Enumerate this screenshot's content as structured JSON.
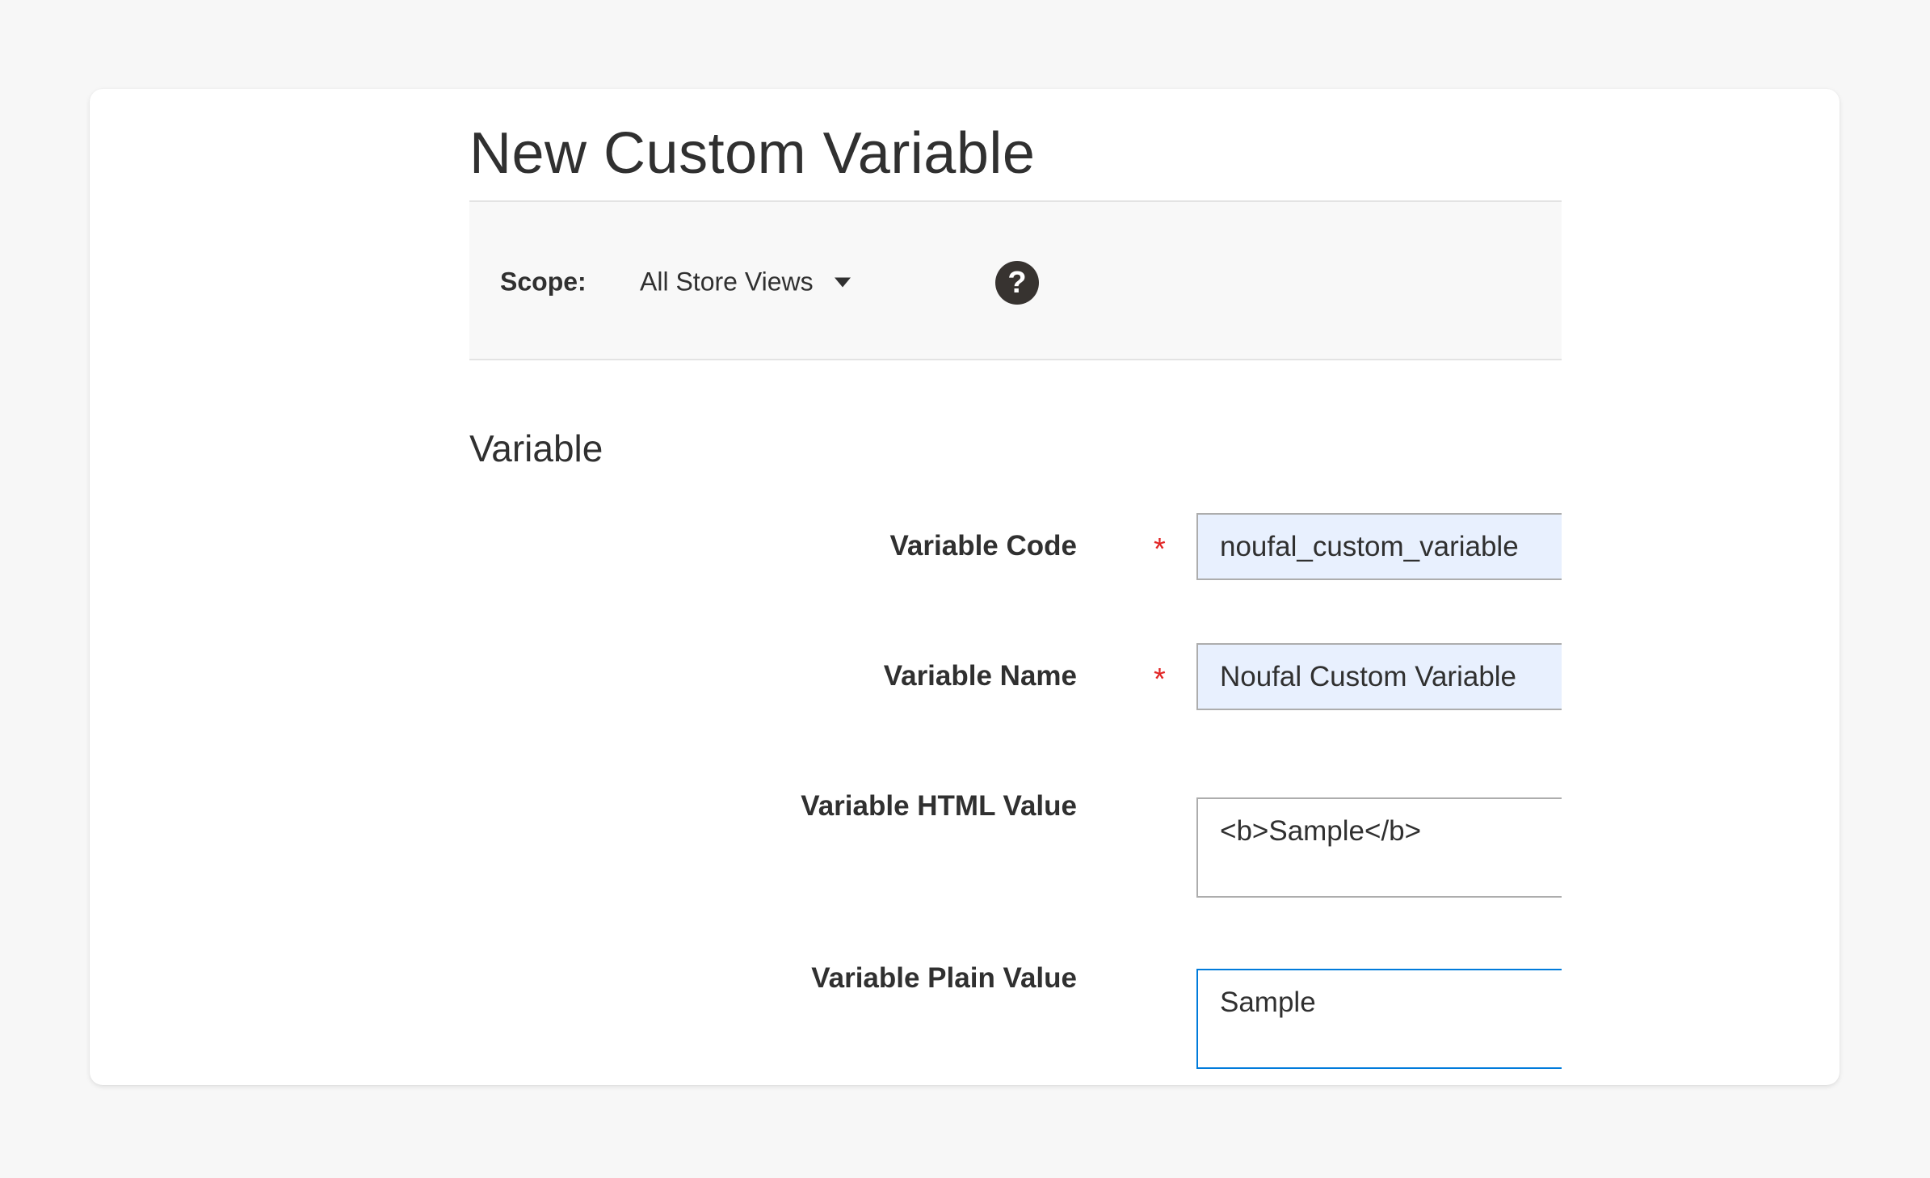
{
  "page": {
    "title": "New Custom Variable"
  },
  "scope": {
    "label": "Scope:",
    "selected": "All Store Views",
    "help_icon": "question-circle-icon",
    "help_glyph": "?"
  },
  "section": {
    "title": "Variable"
  },
  "fields": {
    "code": {
      "label": "Variable Code",
      "required": "*",
      "value": "noufal_custom_variable"
    },
    "name": {
      "label": "Variable Name",
      "required": "*",
      "value": "Noufal Custom Variable"
    },
    "html_value": {
      "label": "Variable HTML Value",
      "value": "<b>Sample</b>"
    },
    "plain_value": {
      "label": "Variable Plain Value",
      "value": "Sample"
    }
  },
  "colors": {
    "required": "#e22626",
    "focus_border": "#007bdb",
    "autofill_bg": "#e8f0fe",
    "help_icon_bg": "#373330"
  }
}
